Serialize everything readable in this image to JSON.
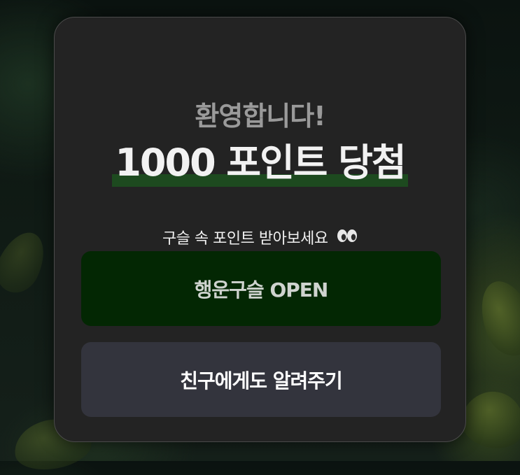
{
  "modal": {
    "welcome": "환영합니다!",
    "headline": "1000 포인트 당첨",
    "subtitle": "구슬 속 포인트 받아보세요",
    "subtitle_icon": "eyes-emoji-icon",
    "open_button": "행운구슬 OPEN",
    "share_button": "친구에게도 알려주기"
  },
  "colors": {
    "card_bg": "#232323",
    "open_button_bg": "#032703",
    "share_button_bg": "#33343d",
    "highlight": "#1d4a1f"
  }
}
